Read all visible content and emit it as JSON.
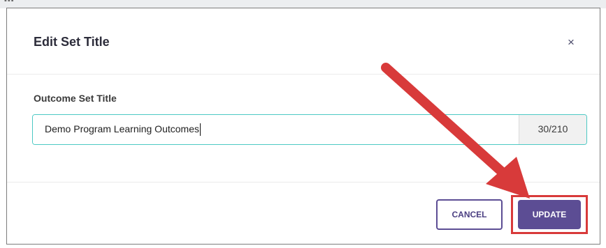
{
  "top_strip": {
    "text": "▪▪▪"
  },
  "dialog": {
    "title": "Edit Set Title",
    "close_label": "×"
  },
  "form": {
    "label": "Outcome Set Title",
    "value": "Demo Program Learning Outcomes",
    "char_count": "30/210"
  },
  "buttons": {
    "cancel": "CANCEL",
    "update": "UPDATE"
  },
  "colors": {
    "primary": "#5c4d94",
    "input_border": "#4cc9c4",
    "annotation": "#d83a3a"
  }
}
